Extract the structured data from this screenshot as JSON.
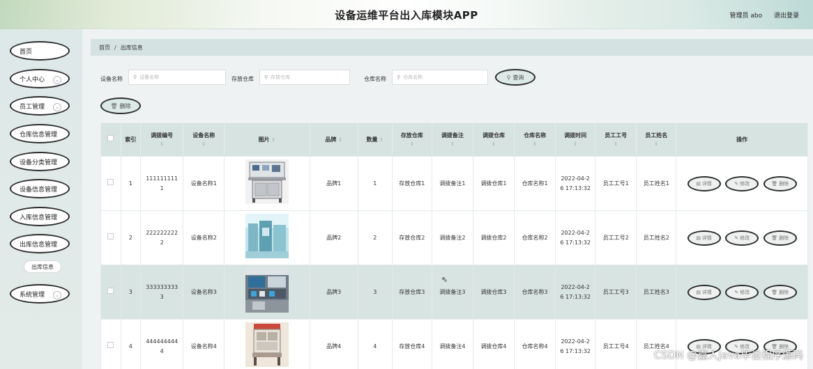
{
  "header": {
    "title": "设备运维平台出入库模块APP",
    "user_label": "管理员 abo",
    "logout_label": "退出登录"
  },
  "sidebar": {
    "items": [
      {
        "label": "首页",
        "has_chevron": false
      },
      {
        "label": "个人中心",
        "has_chevron": true
      },
      {
        "label": "员工管理",
        "has_chevron": true
      },
      {
        "label": "仓库信息管理",
        "has_chevron": false
      },
      {
        "label": "设备分类管理",
        "has_chevron": false
      },
      {
        "label": "设备信息管理",
        "has_chevron": false
      },
      {
        "label": "入库信息管理",
        "has_chevron": false
      },
      {
        "label": "出库信息管理",
        "has_chevron": false
      },
      {
        "label": "系统管理",
        "has_chevron": true
      }
    ],
    "submenu_item": "出库信息"
  },
  "breadcrumb": {
    "home": "首页",
    "separator": "/",
    "current": "出库信息"
  },
  "filters": {
    "device_name_label": "设备名称",
    "device_name_placeholder": "设备名称",
    "storage_label": "存放仓库",
    "storage_placeholder": "存放仓库",
    "warehouse_label": "仓库名称",
    "warehouse_placeholder": "仓库名称",
    "search_button": "查询",
    "delete_button": "删除"
  },
  "table": {
    "headers": {
      "index": "索引",
      "transfer_no": "调拨编号",
      "device_name": "设备名称",
      "image": "图片",
      "brand": "品牌",
      "quantity": "数量",
      "storage": "存放仓库",
      "transfer_note": "调拨备注",
      "transfer_warehouse": "调拨仓库",
      "warehouse_name": "仓库名称",
      "transfer_time": "调拨时间",
      "staff_no": "员工工号",
      "staff_name": "员工姓名",
      "actions": "操作"
    },
    "action_labels": {
      "detail": "详情",
      "edit": "修改",
      "delete": "删除"
    },
    "rows": [
      {
        "index": "1",
        "no_a": "111111111",
        "no_b": "1",
        "device": "设备名称1",
        "image": "device-photo-1",
        "brand": "品牌1",
        "qty": "1",
        "storage": "存放仓库1",
        "note": "调拨备注1",
        "tw": "调拨仓库1",
        "wh": "仓库名称1",
        "time_a": "2022-04-2",
        "time_b": "6 17:13:32",
        "staff_no": "员工工号1",
        "staff_name": "员工姓名1"
      },
      {
        "index": "2",
        "no_a": "222222222",
        "no_b": "2",
        "device": "设备名称2",
        "image": "device-photo-2",
        "brand": "品牌2",
        "qty": "2",
        "storage": "存放仓库2",
        "note": "调拨备注2",
        "tw": "调拨仓库2",
        "wh": "仓库名称2",
        "time_a": "2022-04-2",
        "time_b": "6 17:13:32",
        "staff_no": "员工工号2",
        "staff_name": "员工姓名2"
      },
      {
        "index": "3",
        "no_a": "333333333",
        "no_b": "3",
        "device": "设备名称3",
        "image": "device-photo-3",
        "brand": "品牌3",
        "qty": "3",
        "storage": "存放仓库3",
        "note": "调拨备注3",
        "tw": "调拨仓库3",
        "wh": "仓库名称3",
        "time_a": "2022-04-2",
        "time_b": "6 17:13:32",
        "staff_no": "员工工号3",
        "staff_name": "员工姓名3"
      },
      {
        "index": "4",
        "no_a": "444444444",
        "no_b": "4",
        "device": "设备名称4",
        "image": "device-photo-4",
        "brand": "品牌4",
        "qty": "4",
        "storage": "存放仓库4",
        "note": "调拨备注4",
        "tw": "调拨仓库4",
        "wh": "仓库名称4",
        "time_a": "2022-04-2",
        "time_b": "6 17:13:32",
        "staff_no": "员工工号4",
        "staff_name": "员工姓名4"
      }
    ]
  },
  "watermark": "CSDN @嘉人Java毕设程序源码",
  "colors": {
    "header_bg": "#eef3ea",
    "sidebar_bg": "#dde8e8",
    "table_header_bg": "#d6e3e1",
    "highlight_row_bg": "#d8e4e2",
    "pill_border": "#2c2c2c"
  }
}
